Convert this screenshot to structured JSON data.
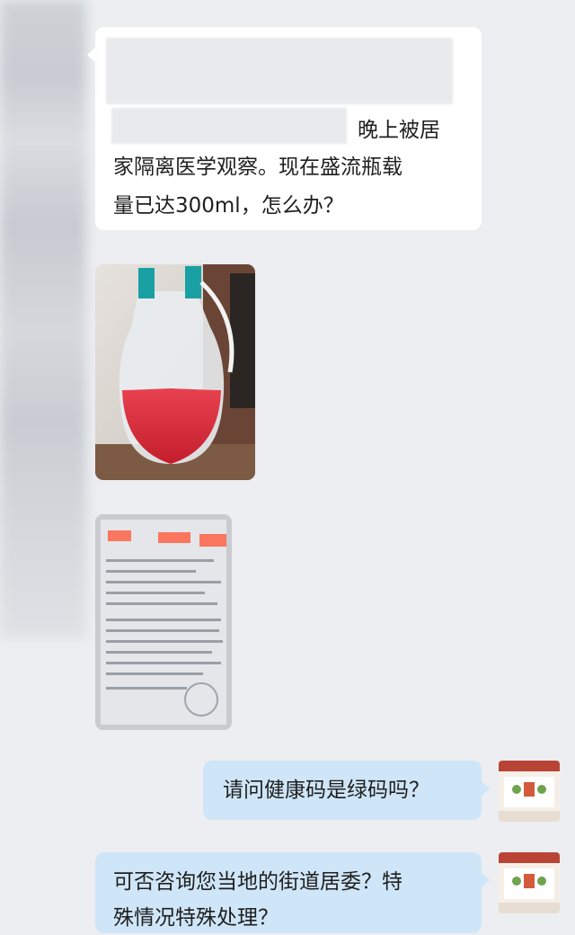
{
  "chat": {
    "messages": [
      {
        "side": "incoming",
        "lines": [
          "晚上被居",
          "家隔离医学观察。现在盛流瓶载",
          "量已达300ml，怎么办？"
        ]
      },
      {
        "side": "incoming",
        "type": "image",
        "icon": "drainage-bottle-photo-icon"
      },
      {
        "side": "incoming",
        "type": "image",
        "icon": "medical-document-photo-icon"
      },
      {
        "side": "outgoing",
        "text": "请问健康码是绿码吗？"
      },
      {
        "side": "outgoing",
        "lines": [
          "可否咨询您当地的街道居委？特",
          "殊情况特殊处理？"
        ]
      }
    ]
  },
  "colors": {
    "background": "#eceef1",
    "incoming_bubble": "#ffffff",
    "outgoing_bubble": "#cfe6f8",
    "text": "#1f1f1f"
  }
}
